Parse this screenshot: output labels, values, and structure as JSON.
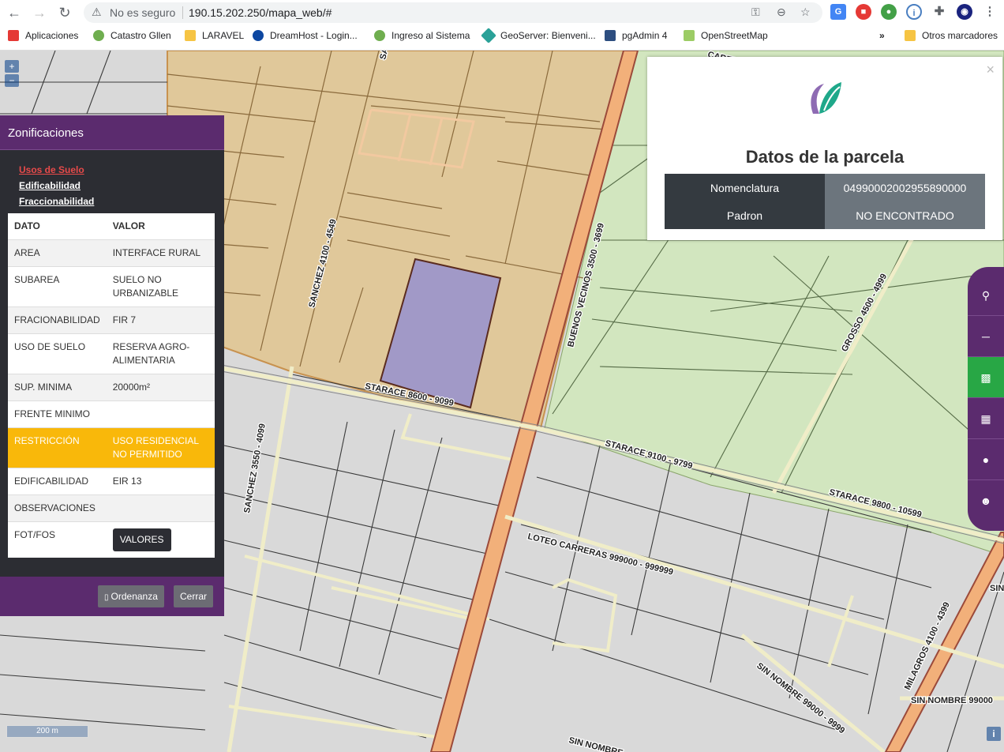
{
  "browser": {
    "back_icon": "←",
    "forward_icon": "→",
    "reload_icon": "↻",
    "security_text": "No es seguro",
    "url": "190.15.202.250/mapa_web/#",
    "bookmarks": [
      "Aplicaciones",
      "Catastro Gllen",
      "LARAVEL",
      "DreamHost - Login...",
      "Ingreso al Sistema",
      "GeoServer: Bienveni...",
      "pgAdmin 4",
      "OpenStreetMap"
    ],
    "more_bookmarks": "»",
    "other_bookmarks": "Otros marcadores"
  },
  "map": {
    "zoom_in": "+",
    "zoom_out": "−",
    "scale_label": "200 m",
    "info_label": "i",
    "street_labels": [
      "SANCHEZ 4100 - 4549",
      "BUENOS VECINOS 3500 - 3699",
      "STARACE 8600 - 9099",
      "STARACE 9100 - 9799",
      "STARACE 9800 - 10599",
      "GROSSO 4500 - 4999",
      "SANCHEZ 3550 - 4099",
      "LOTEO CARRERAS 999000 - 999999",
      "SIN NOMBRE 99000 - 9999",
      "MILAGROS 4100 - 4399",
      "SIN NOMBRE 99000",
      "SIN NOMBRE",
      "SIN NOMBRE",
      "CABELLO",
      "SA"
    ]
  },
  "zonificaciones": {
    "title": "Zonificaciones",
    "links": [
      "Usos de Suelo",
      "Edificabilidad",
      "Fraccionabilidad"
    ],
    "header": [
      "DATO",
      "VALOR"
    ],
    "rows": [
      [
        "AREA",
        "INTERFACE RURAL"
      ],
      [
        "SUBAREA",
        "SUELO NO URBANIZABLE"
      ],
      [
        "FRACIONABILIDAD",
        "FIR 7"
      ],
      [
        "USO DE SUELO",
        "RESERVA AGRO-ALIMENTARIA"
      ],
      [
        "SUP. MINIMA",
        "20000m²"
      ],
      [
        "FRENTE MINIMO",
        ""
      ],
      [
        "RESTRICCIÓN",
        "USO RESIDENCIAL NO PERMITIDO"
      ],
      [
        "EDIFICABILIDAD",
        "EIR 13"
      ],
      [
        "OBSERVACIONES",
        ""
      ],
      [
        "FOT/FOS",
        ""
      ]
    ],
    "valores_button": "VALORES",
    "ordenanza_button": "Ordenanza",
    "cerrar_button": "Cerrar"
  },
  "parcela": {
    "close": "×",
    "title": "Datos de la parcela",
    "rows": [
      [
        "Nomenclatura",
        "04990002002955890000"
      ],
      [
        "Padron",
        "NO ENCONTRADO"
      ]
    ]
  },
  "colors": {
    "zone_orange": "#e0c89a",
    "zone_green": "#d2e6bf",
    "selected_parcel": "#a199c7",
    "panel_purple": "#5b2b6e",
    "restriction_yellow": "#f9b80a",
    "active_tool_green": "#28a745"
  },
  "tools": [
    "search-icon",
    "signpost-icon",
    "map-icon",
    "grid-icon",
    "globe-icon",
    "user-icon"
  ]
}
